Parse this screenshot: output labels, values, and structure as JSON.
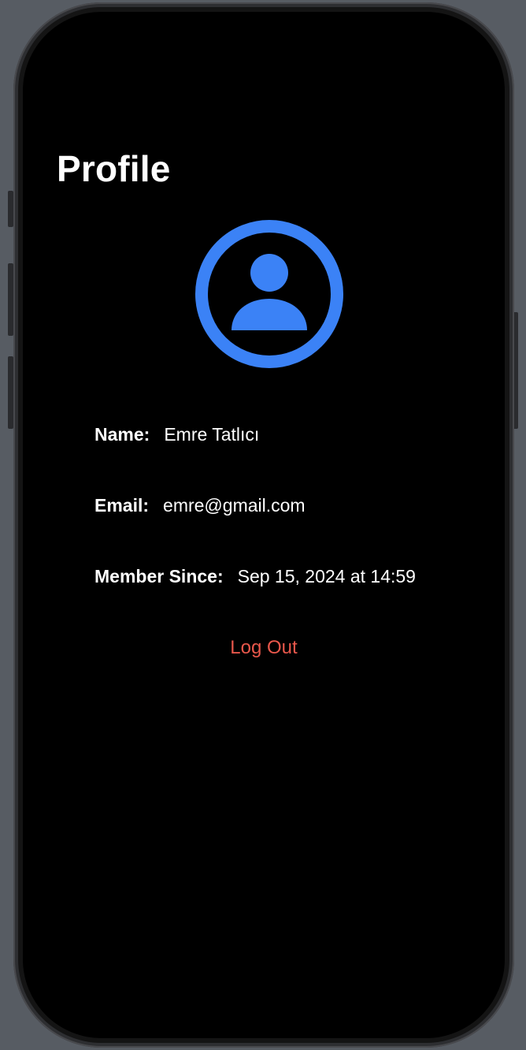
{
  "colors": {
    "accent_blue": "#3b82f6",
    "destructive_red": "#e8574b",
    "background": "#000000",
    "text": "#ffffff"
  },
  "profile": {
    "title": "Profile",
    "avatar_icon": "person-crop-circle-icon",
    "fields": {
      "name": {
        "label": "Name:",
        "value": "Emre Tatlıcı"
      },
      "email": {
        "label": "Email:",
        "value": "emre@gmail.com"
      },
      "member_since": {
        "label": "Member Since:",
        "value": "Sep 15, 2024 at 14:59"
      }
    },
    "logout_label": "Log Out"
  }
}
